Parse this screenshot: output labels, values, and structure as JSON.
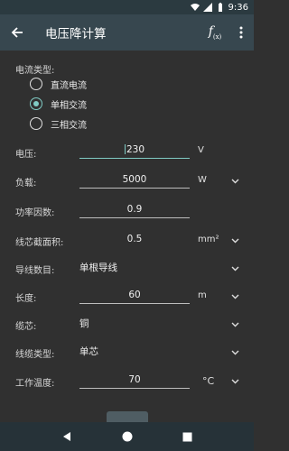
{
  "status_bar": {
    "time": "9:36"
  },
  "app_bar": {
    "title": "电压降计算",
    "fx_label": "f",
    "fx_sub": "(x)"
  },
  "current_type": {
    "label": "电流类型:",
    "options": [
      "直流电流",
      "单相交流",
      "三相交流"
    ],
    "selected": "单相交流"
  },
  "voltage": {
    "label": "电压:",
    "value": "230",
    "unit": "V"
  },
  "load": {
    "label": "负载:",
    "value": "5000",
    "unit": "W"
  },
  "power_factor": {
    "label": "功率因数:",
    "value": "0.9"
  },
  "cross_section": {
    "label": "线芯截面积:",
    "value": "0.5",
    "unit": "mm²"
  },
  "wire_count": {
    "label": "导线数目:",
    "value": "单根导线"
  },
  "length": {
    "label": "长度:",
    "value": "60",
    "unit": "m"
  },
  "core": {
    "label": "缆芯:",
    "value": "铜"
  },
  "cable_type": {
    "label": "线缆类型:",
    "value": "单芯"
  },
  "temperature": {
    "label": "工作温度:",
    "value": "70",
    "unit": "°C"
  },
  "colors": {
    "accent": "#80cbc4",
    "app_bar": "#37474f",
    "background": "#303030"
  }
}
